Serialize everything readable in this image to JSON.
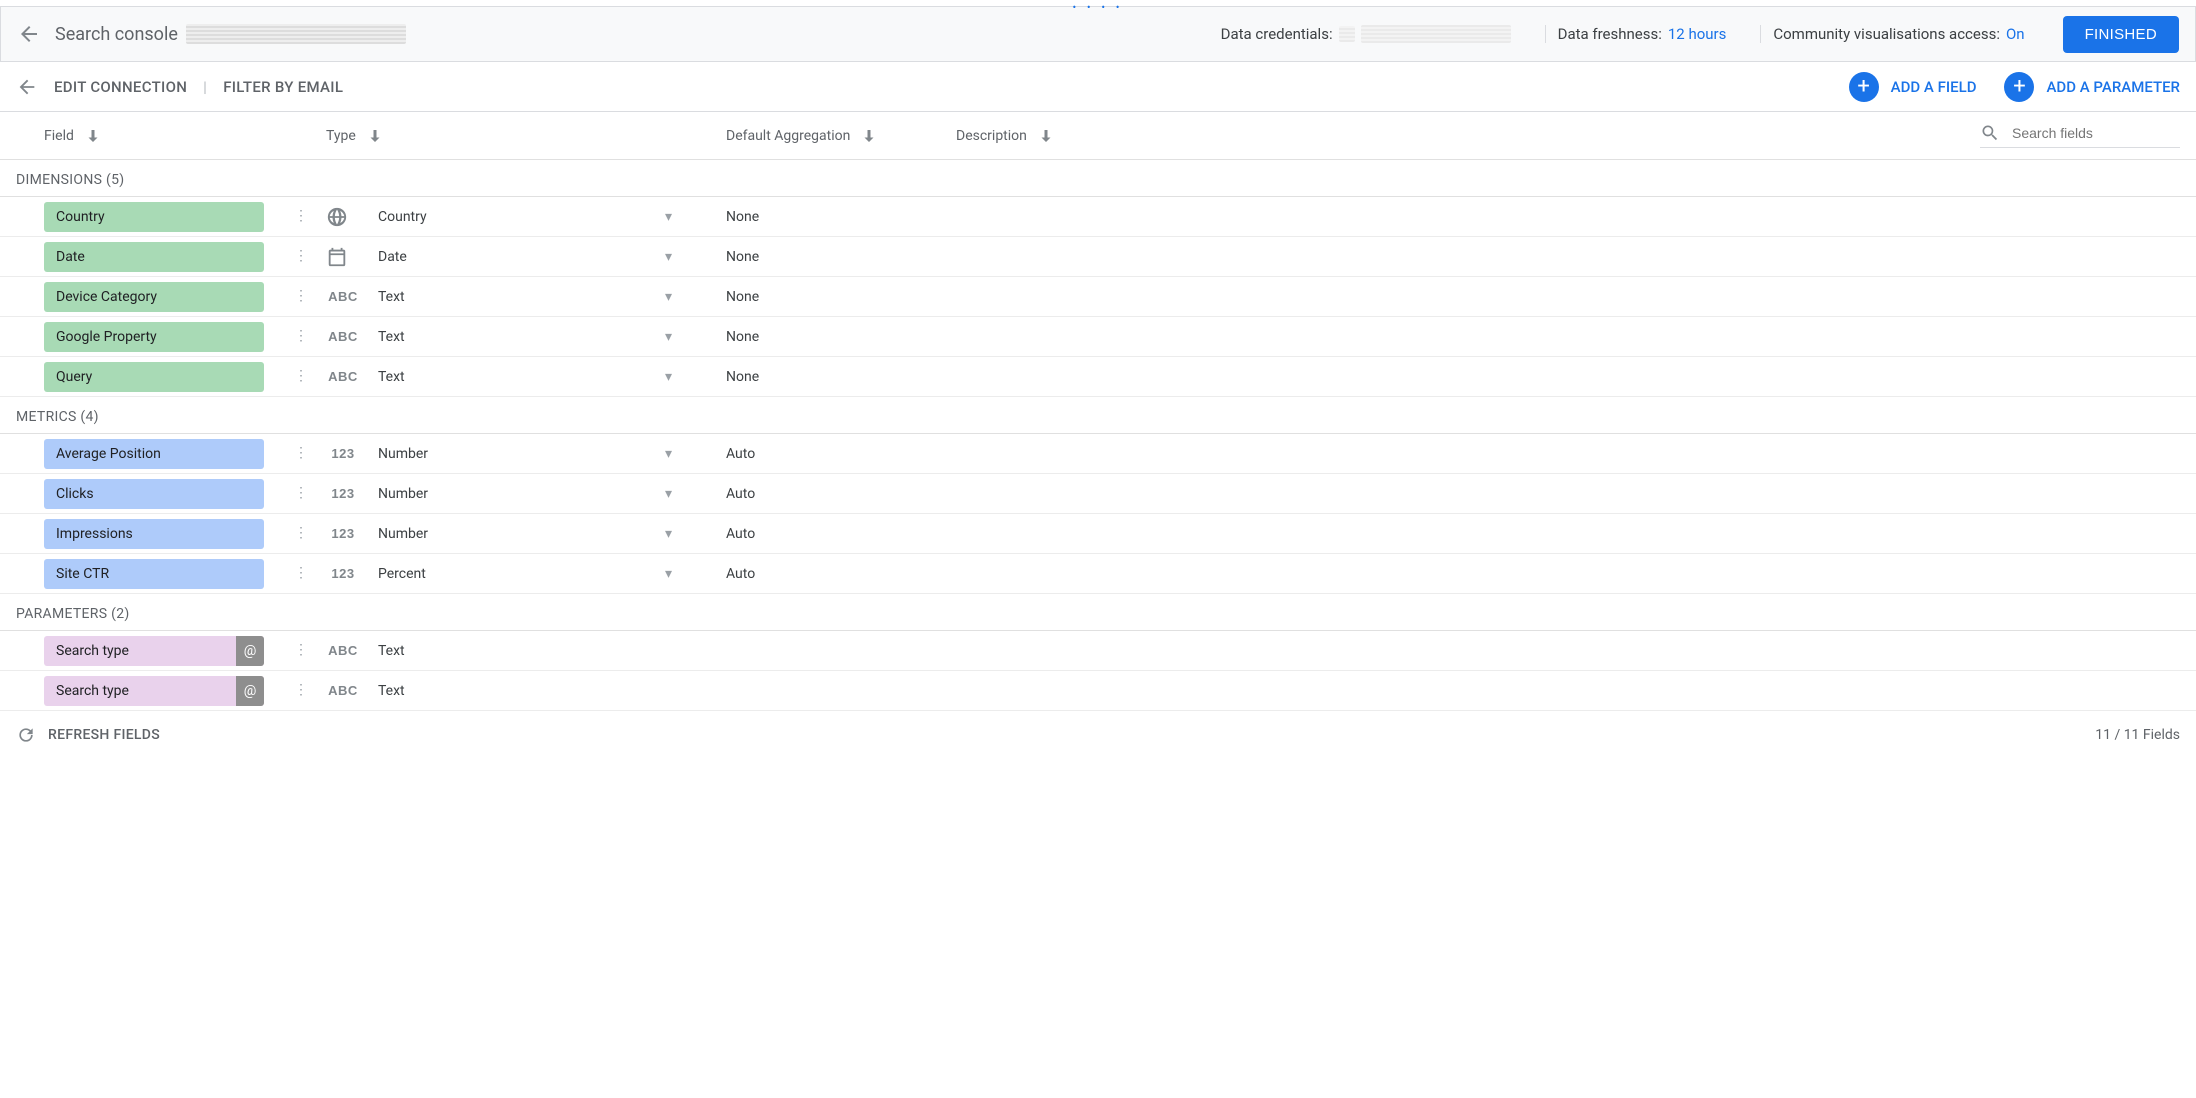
{
  "top": {
    "title": "Search console",
    "data_credentials_label": "Data credentials:",
    "freshness_label": "Data freshness:",
    "freshness_value": "12 hours",
    "community_label": "Community visualisations access:",
    "community_value": "On",
    "finished_label": "FINISHED"
  },
  "secondary": {
    "edit_connection": "EDIT CONNECTION",
    "filter_by_email": "FILTER BY EMAIL",
    "add_field": "ADD A FIELD",
    "add_parameter": "ADD A PARAMETER"
  },
  "columns": {
    "field": "Field",
    "type": "Type",
    "aggregation": "Default Aggregation",
    "description": "Description",
    "search_placeholder": "Search fields"
  },
  "groups": [
    {
      "label": "DIMENSIONS (5)",
      "kind": "dim",
      "rows": [
        {
          "name": "Country",
          "type_icon": "globe",
          "type": "Country",
          "agg": "None"
        },
        {
          "name": "Date",
          "type_icon": "calendar",
          "type": "Date",
          "agg": "None"
        },
        {
          "name": "Device Category",
          "type_icon": "abc",
          "type": "Text",
          "agg": "None"
        },
        {
          "name": "Google Property",
          "type_icon": "abc",
          "type": "Text",
          "agg": "None"
        },
        {
          "name": "Query",
          "type_icon": "abc",
          "type": "Text",
          "agg": "None"
        }
      ]
    },
    {
      "label": "METRICS (4)",
      "kind": "met",
      "rows": [
        {
          "name": "Average Position",
          "type_icon": "num",
          "type": "Number",
          "agg": "Auto"
        },
        {
          "name": "Clicks",
          "type_icon": "num",
          "type": "Number",
          "agg": "Auto"
        },
        {
          "name": "Impressions",
          "type_icon": "num",
          "type": "Number",
          "agg": "Auto"
        },
        {
          "name": "Site CTR",
          "type_icon": "num",
          "type": "Percent",
          "agg": "Auto"
        }
      ]
    },
    {
      "label": "PARAMETERS (2)",
      "kind": "par",
      "rows": [
        {
          "name": "Search type",
          "type_icon": "abc",
          "type": "Text",
          "badge": "@"
        },
        {
          "name": "Search type",
          "type_icon": "abc",
          "type": "Text",
          "badge": "@"
        }
      ]
    }
  ],
  "footer": {
    "refresh": "REFRESH FIELDS",
    "count": "11 / 11 Fields"
  }
}
